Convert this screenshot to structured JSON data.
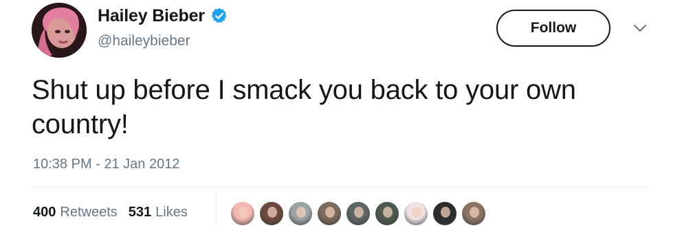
{
  "user": {
    "display_name": "Hailey Bieber",
    "handle": "@haileybieber",
    "verified": true,
    "avatar_icon": "profile-photo"
  },
  "follow_button": {
    "label": "Follow"
  },
  "menu_caret": {
    "icon": "chevron-down-icon"
  },
  "tweet": {
    "text": "Shut up before I smack you back to your own country!",
    "timestamp": "10:38 PM - 21 Jan 2012"
  },
  "stats": {
    "retweets_count": "400",
    "retweets_label": "Retweets",
    "likes_count": "531",
    "likes_label": "Likes"
  },
  "likers": [
    {
      "name": "liker-avatar-1",
      "color": "#f3b9b1"
    },
    {
      "name": "liker-avatar-2",
      "color": "#6b4a3d"
    },
    {
      "name": "liker-avatar-3",
      "color": "#9aa5a8"
    },
    {
      "name": "liker-avatar-4",
      "color": "#7c6a5c"
    },
    {
      "name": "liker-avatar-5",
      "color": "#5c6664"
    },
    {
      "name": "liker-avatar-6",
      "color": "#4d5a4e"
    },
    {
      "name": "liker-avatar-7",
      "color": "#f0e2e4"
    },
    {
      "name": "liker-avatar-8",
      "color": "#2c2c2e"
    },
    {
      "name": "liker-avatar-9",
      "color": "#8b7463"
    }
  ],
  "colors": {
    "text_primary": "#14171a",
    "text_secondary": "#657786",
    "verified_blue": "#1da1f2",
    "divider": "#e6ecf0"
  }
}
